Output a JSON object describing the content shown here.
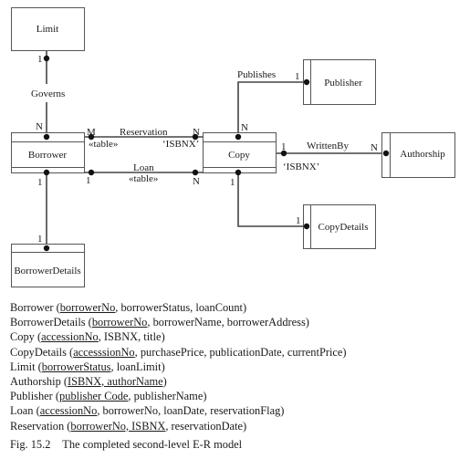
{
  "entities": {
    "limit": "Limit",
    "borrower": "Borrower",
    "borrower_details": "BorrowerDetails",
    "copy": "Copy",
    "publisher": "Publisher",
    "authorship": "Authorship",
    "copy_details": "CopyDetails"
  },
  "relationships": {
    "governs": {
      "label": "Governs",
      "card_limit": "1",
      "card_borrower": "N"
    },
    "reservation": {
      "label": "Reservation",
      "stereotype": "«table»",
      "key": "‘ISBNX’",
      "card_borrower": "M",
      "card_copy": "N"
    },
    "loan": {
      "label": "Loan",
      "stereotype": "«table»",
      "card_borrower": "1",
      "card_copy": "N"
    },
    "publishes": {
      "label": "Publishes",
      "card_publisher": "1",
      "card_copy": "N"
    },
    "written_by": {
      "label": "WrittenBy",
      "key": "‘ISBNX’",
      "card_copy": "1",
      "card_authorship": "N"
    },
    "borrower_details_link": {
      "card_borrower": "1",
      "card_details": "1"
    },
    "copy_details_link": {
      "card_copy": "1",
      "card_details": "1"
    }
  },
  "relations": [
    {
      "name": "Borrower",
      "parts": [
        {
          "t": "borrowerNo",
          "key": true
        },
        {
          "t": ", borrowerStatus, loanCount",
          "key": false
        }
      ]
    },
    {
      "name": "BorrowerDetails",
      "parts": [
        {
          "t": "borrowerNo",
          "key": true
        },
        {
          "t": ", borrowerName, borrowerAddress",
          "key": false
        }
      ]
    },
    {
      "name": "Copy",
      "parts": [
        {
          "t": "accessionNo",
          "key": true
        },
        {
          "t": ", ISBNX, title",
          "key": false
        }
      ]
    },
    {
      "name": "CopyDetails",
      "parts": [
        {
          "t": "accesssionNo",
          "key": true
        },
        {
          "t": ", purchasePrice, publicationDate, currentPrice",
          "key": false
        }
      ]
    },
    {
      "name": "Limit",
      "parts": [
        {
          "t": "borrowerStatus",
          "key": true
        },
        {
          "t": ", loanLimit",
          "key": false
        }
      ]
    },
    {
      "name": "Authorship",
      "parts": [
        {
          "t": "ISBNX, authorName",
          "key": true
        }
      ]
    },
    {
      "name": "Publisher",
      "parts": [
        {
          "t": "publisher Code",
          "key": true
        },
        {
          "t": ", publisherName",
          "key": false
        }
      ]
    },
    {
      "name": "Loan",
      "parts": [
        {
          "t": "accessionNo",
          "key": true
        },
        {
          "t": ", borrowerNo, loanDate, reservationFlag",
          "key": false
        }
      ]
    },
    {
      "name": "Reservation",
      "parts": [
        {
          "t": "borrowerNo, ISBNX",
          "key": true
        },
        {
          "t": ", reservationDate",
          "key": false
        }
      ]
    }
  ],
  "caption": {
    "figure": "Fig. 15.2",
    "text": "The completed second-level E-R model"
  }
}
